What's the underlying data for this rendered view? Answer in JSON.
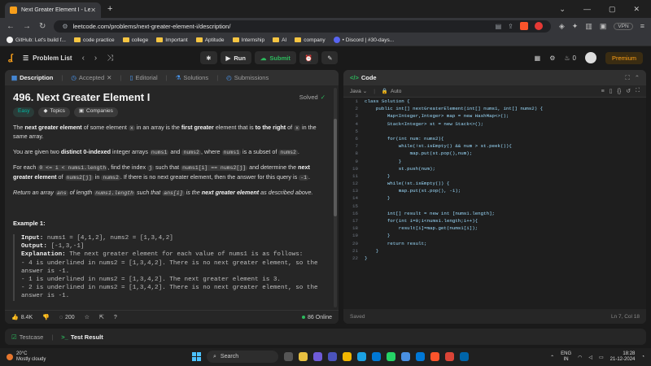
{
  "browser": {
    "tab_title": "Next Greater Element I - LeetC",
    "new_tab": "+",
    "url": "leetcode.com/problems/next-greater-element-i/description/",
    "vpn_label": "VPN"
  },
  "bookmarks": [
    {
      "label": "GitHub: Let's build f...",
      "icon": "github-icon"
    },
    {
      "label": "code practice",
      "icon": "folder-icon"
    },
    {
      "label": "college",
      "icon": "folder-icon"
    },
    {
      "label": "Important",
      "icon": "folder-icon"
    },
    {
      "label": "Aptitude",
      "icon": "folder-icon"
    },
    {
      "label": "Internship",
      "icon": "folder-icon"
    },
    {
      "label": "AI",
      "icon": "folder-icon"
    },
    {
      "label": "company",
      "icon": "folder-icon"
    },
    {
      "label": "• Discord | #30-days...",
      "icon": "discord-icon"
    }
  ],
  "lcnav": {
    "problem_list": "Problem List",
    "run": "Run",
    "submit": "Submit",
    "streak": "0",
    "premium": "Premium"
  },
  "left_tabs": [
    "Description",
    "Accepted",
    "Editorial",
    "Solutions",
    "Submissions"
  ],
  "problem": {
    "title": "496. Next Greater Element I",
    "status": "Solved",
    "difficulty": "Easy",
    "tag_topics": "Topics",
    "tag_companies": "Companies",
    "p1_a": "The ",
    "p1_b": "next greater element",
    "p1_c": " of some element ",
    "p1_d": "x",
    "p1_e": " in an array is the ",
    "p1_f": "first greater",
    "p1_g": " element that is ",
    "p1_h": "to the right",
    "p1_i": " of ",
    "p1_j": "x",
    "p1_k": " in the same array.",
    "p2_a": "You are given two ",
    "p2_b": "distinct 0-indexed",
    "p2_c": " integer arrays ",
    "p2_d": "nums1",
    "p2_e": " and ",
    "p2_f": "nums2",
    "p2_g": ", where ",
    "p2_h": "nums1",
    "p2_i": " is a subset of ",
    "p2_j": "nums2",
    "p2_k": ".",
    "p3_a": "For each ",
    "p3_b": "0 <= i < nums1.length",
    "p3_c": ", find the index ",
    "p3_d": "j",
    "p3_e": " such that ",
    "p3_f": "nums1[i] == nums2[j]",
    "p3_g": " and determine the ",
    "p3_h": "next greater element",
    "p3_i": " of ",
    "p3_j": "nums2[j]",
    "p3_k": " in ",
    "p3_l": "nums2",
    "p3_m": ". If there is no next greater element, then the answer for this query is ",
    "p3_n": "-1",
    "p3_o": ".",
    "p4_a": "Return an array ",
    "p4_b": "ans",
    "p4_c": " of length ",
    "p4_d": "nums1.length",
    "p4_e": " such that ",
    "p4_f": "ans[i]",
    "p4_g": " is the ",
    "p4_h": "next greater element",
    "p4_i": " as described above.",
    "example_title": "Example 1:",
    "ex_input_label": "Input:",
    "ex_input": " nums1 = [4,1,2], nums2 = [1,3,4,2]",
    "ex_output_label": "Output:",
    "ex_output": " [-1,3,-1]",
    "ex_expl_label": "Explanation:",
    "ex_expl": " The next greater element for each value of nums1 is as follows:",
    "ex_l1": "- 4 is underlined in nums2 = [1,3,4,2]. There is no next greater element, so the",
    "ex_l2": "answer is -1.",
    "ex_l3": "- 1 is underlined in nums2 = [1,3,4,2]. The next greater element is 3.",
    "ex_l4": "- 2 is underlined in nums2 = [1,3,4,2]. There is no next greater element, so the",
    "ex_l5": "answer is -1."
  },
  "left_footer": {
    "likes": "8.4K",
    "comments": "200",
    "online": "86 Online"
  },
  "code_panel": {
    "title": "Code",
    "language": "Java",
    "mode": "Auto",
    "status": "Saved",
    "cursor": "Ln 7, Col 18",
    "lines": [
      "class Solution {",
      "    public int[] nextGreaterElement(int[] nums1, int[] nums2) {",
      "        Map<Integer,Integer> map = new HashMap<>();",
      "        Stack<Integer> st = new Stack<>();",
      "",
      "        for(int num: nums2){",
      "            while(!st.isEmpty() && num > st.peek()){",
      "                map.put(st.pop(),num);",
      "            }",
      "            st.push(num);",
      "        }",
      "        while(!st.isEmpty()) {",
      "            map.put(st.pop(), -1);",
      "        }",
      "",
      "        int[] result = new int [nums1.length];",
      "        for(int i=0;i<nums1.length;i++){",
      "            result[i]=map.get(nums1[i]);",
      "        }",
      "        return result;",
      "    }",
      "}"
    ]
  },
  "bottom_tabs": {
    "testcase": "Testcase",
    "test_result": "Test Result"
  },
  "taskbar": {
    "temp": "20°C",
    "weather": "Mostly cloudy",
    "search": "Search",
    "lang": "ENG",
    "lang2": "IN",
    "time": "18:28",
    "date": "21-12-2024"
  }
}
